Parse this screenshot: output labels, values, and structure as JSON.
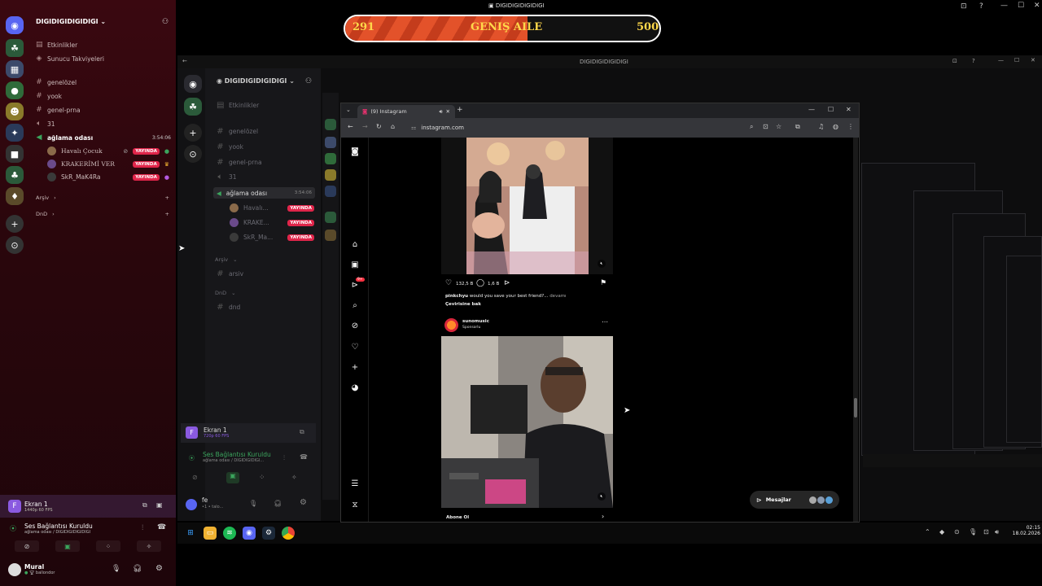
{
  "score_bar": {
    "left_value": "291",
    "center_label": "GENIŞ AILE",
    "right_value": "500",
    "progress_percent": 58
  },
  "window": {
    "title": "DIGIDIGIDIGIDIGI"
  },
  "outer_discord": {
    "server_name": "DIGIDIGIDIGIDIGI",
    "menu_items": [
      "Etkinlikler",
      "Sunucu Takviyeleri"
    ],
    "channels": [
      "genelözel",
      "yook",
      "genel-prna",
      "31"
    ],
    "voice_channel": {
      "name": "ağlama odası",
      "timer": "3:54:06"
    },
    "voice_users": [
      {
        "name": "Havalı Çocuk",
        "badge": "YAYINDA"
      },
      {
        "name": "KRAKERİMİ VER",
        "badge": "YAYINDA"
      },
      {
        "name": "SkR_MaK4Ra",
        "badge": "YAYINDA"
      }
    ],
    "categories": [
      "Arşiv",
      "DnD"
    ],
    "stream_panel": {
      "title": "Ekran 1",
      "subtitle": "1440p 60 FPS"
    },
    "voice_status": {
      "title": "Ses Bağlantısı Kuruldu",
      "subtitle": "ağlama odası / DIGIDIGIDIGIDIGI"
    },
    "user": {
      "name": "Mural",
      "status": "ballondor"
    }
  },
  "mid_discord": {
    "server_name": "DIGIDIGIDIGIDIGI",
    "menu_item": "Etkinlikler",
    "channels": [
      "genelözel",
      "yook",
      "genel-prna",
      "31"
    ],
    "voice_channel": {
      "name": "ağlama odası",
      "timer": "3:54:06"
    },
    "voice_users": [
      {
        "name": "Havalı...",
        "badge": "YAYINDA"
      },
      {
        "name": "KRAKE...",
        "badge": "YAYINDA"
      },
      {
        "name": "SkR_Ma...",
        "badge": "YAYINDA"
      }
    ],
    "categories": [
      "Arşiv",
      "DnD"
    ],
    "category_channels": [
      "arsiv",
      "dnd"
    ],
    "stream_panel": {
      "title": "Ekran 1",
      "subtitle": "720p 60 FPS"
    },
    "voice_status": {
      "title": "Ses Bağlantısı Kuruldu",
      "subtitle": "ağlama odası / DIGIDIGIDIGI..."
    },
    "user": {
      "name": "fe",
      "status": "•1 • talo..."
    }
  },
  "browser": {
    "tab_title": "(9) Instagram",
    "url": "instagram.com",
    "post1": {
      "likes": "132,5 B",
      "comments": "1,6 B",
      "username": "pinkchyu",
      "caption": "would you save your best friend?...",
      "more": "devamı",
      "translate": "Çevirisine bak"
    },
    "post2": {
      "username": "sunomusic",
      "sponsored": "Sponsorlu",
      "cta": "Abone Ol"
    },
    "messages_label": "Mesajlar",
    "notif_count": "9+"
  },
  "taskbar": {
    "time": "02:15",
    "date": "18.02.2026"
  }
}
